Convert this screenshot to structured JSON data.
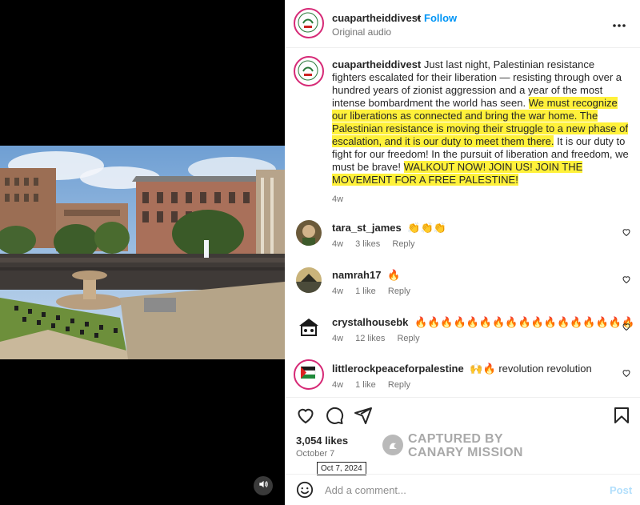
{
  "header": {
    "username": "cuapartheiddivest",
    "separator": "•",
    "follow_label": "Follow",
    "audio": "Original audio",
    "more_icon": "more-horizontal-icon"
  },
  "caption": {
    "username": "cuapartheiddivest",
    "part1": "Just last night, Palestinian resistance fighters escalated for their liberation — resisting through over a hundred years of zionist aggression and a year of the most intense bombardment the world has seen.",
    "highlight1": "We must recognize our liberations as connected and bring the war home. The Palestinian resistance is moving their struggle to a new phase of escalation, and it is our duty to meet them there.",
    "part2": "It is our duty to fight for our freedom! In the pursuit of liberation and freedom, we must be brave!",
    "highlight2": "WALKOUT NOW! JOIN US! JOIN THE MOVEMENT FOR A FREE PALESTINE!",
    "age": "4w",
    "highlight_color": "#fff13a"
  },
  "comments": [
    {
      "username": "tara_st_james",
      "text": "👏👏👏",
      "age": "4w",
      "likes": "3 likes",
      "reply": "Reply"
    },
    {
      "username": "namrah17",
      "text": "🔥",
      "age": "4w",
      "likes": "1 like",
      "reply": "Reply"
    },
    {
      "username": "crystalhousebk",
      "text": "🔥🔥🔥🔥🔥🔥🔥🔥🔥🔥🔥🔥🔥🔥🔥🔥🔥",
      "age": "4w",
      "likes": "12 likes",
      "reply": "Reply"
    },
    {
      "username": "littlerockpeaceforpalestine",
      "text": "🙌🔥 revolution revolution",
      "age": "4w",
      "likes": "1 like",
      "reply": "Reply"
    }
  ],
  "actions": {
    "like_icon": "heart-icon",
    "comment_icon": "comment-icon",
    "share_icon": "share-icon",
    "save_icon": "bookmark-icon"
  },
  "stats": {
    "likes": "3,054 likes",
    "date": "October 7",
    "tooltip": "Oct 7, 2024"
  },
  "watermark": {
    "line1": "CAPTURED BY",
    "line2": "CANARY MISSION"
  },
  "add_comment": {
    "emoji_icon": "emoji-icon",
    "placeholder": "Add a comment...",
    "post_label": "Post"
  },
  "video": {
    "volume_icon": "volume-icon"
  },
  "colors": {
    "accent": "#0095f6",
    "story_ring": "#d62976",
    "post_disabled": "#b2dffc"
  }
}
